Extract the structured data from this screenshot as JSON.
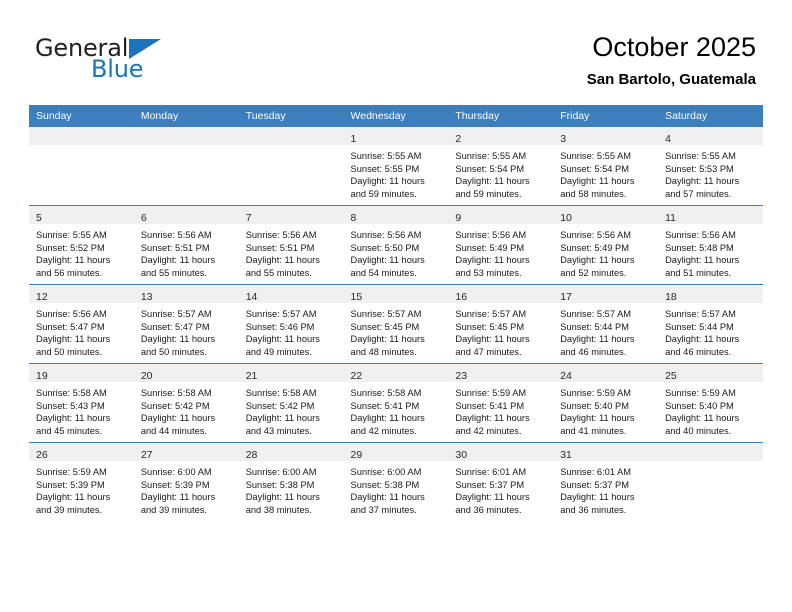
{
  "brand": {
    "name_part1": "General",
    "name_part2": "Blue"
  },
  "header": {
    "title": "October 2025",
    "subtitle": "San Bartolo, Guatemala"
  },
  "colors": {
    "header_blue": "#3d7ebd",
    "brand_blue": "#1b75bb",
    "band_gray": "#f0f0f0"
  },
  "weekdays": [
    "Sunday",
    "Monday",
    "Tuesday",
    "Wednesday",
    "Thursday",
    "Friday",
    "Saturday"
  ],
  "weeks": [
    [
      {
        "day": "",
        "sunrise": "",
        "sunset": "",
        "daylight1": "",
        "daylight2": ""
      },
      {
        "day": "",
        "sunrise": "",
        "sunset": "",
        "daylight1": "",
        "daylight2": ""
      },
      {
        "day": "",
        "sunrise": "",
        "sunset": "",
        "daylight1": "",
        "daylight2": ""
      },
      {
        "day": "1",
        "sunrise": "Sunrise: 5:55 AM",
        "sunset": "Sunset: 5:55 PM",
        "daylight1": "Daylight: 11 hours",
        "daylight2": "and 59 minutes."
      },
      {
        "day": "2",
        "sunrise": "Sunrise: 5:55 AM",
        "sunset": "Sunset: 5:54 PM",
        "daylight1": "Daylight: 11 hours",
        "daylight2": "and 59 minutes."
      },
      {
        "day": "3",
        "sunrise": "Sunrise: 5:55 AM",
        "sunset": "Sunset: 5:54 PM",
        "daylight1": "Daylight: 11 hours",
        "daylight2": "and 58 minutes."
      },
      {
        "day": "4",
        "sunrise": "Sunrise: 5:55 AM",
        "sunset": "Sunset: 5:53 PM",
        "daylight1": "Daylight: 11 hours",
        "daylight2": "and 57 minutes."
      }
    ],
    [
      {
        "day": "5",
        "sunrise": "Sunrise: 5:55 AM",
        "sunset": "Sunset: 5:52 PM",
        "daylight1": "Daylight: 11 hours",
        "daylight2": "and 56 minutes."
      },
      {
        "day": "6",
        "sunrise": "Sunrise: 5:56 AM",
        "sunset": "Sunset: 5:51 PM",
        "daylight1": "Daylight: 11 hours",
        "daylight2": "and 55 minutes."
      },
      {
        "day": "7",
        "sunrise": "Sunrise: 5:56 AM",
        "sunset": "Sunset: 5:51 PM",
        "daylight1": "Daylight: 11 hours",
        "daylight2": "and 55 minutes."
      },
      {
        "day": "8",
        "sunrise": "Sunrise: 5:56 AM",
        "sunset": "Sunset: 5:50 PM",
        "daylight1": "Daylight: 11 hours",
        "daylight2": "and 54 minutes."
      },
      {
        "day": "9",
        "sunrise": "Sunrise: 5:56 AM",
        "sunset": "Sunset: 5:49 PM",
        "daylight1": "Daylight: 11 hours",
        "daylight2": "and 53 minutes."
      },
      {
        "day": "10",
        "sunrise": "Sunrise: 5:56 AM",
        "sunset": "Sunset: 5:49 PM",
        "daylight1": "Daylight: 11 hours",
        "daylight2": "and 52 minutes."
      },
      {
        "day": "11",
        "sunrise": "Sunrise: 5:56 AM",
        "sunset": "Sunset: 5:48 PM",
        "daylight1": "Daylight: 11 hours",
        "daylight2": "and 51 minutes."
      }
    ],
    [
      {
        "day": "12",
        "sunrise": "Sunrise: 5:56 AM",
        "sunset": "Sunset: 5:47 PM",
        "daylight1": "Daylight: 11 hours",
        "daylight2": "and 50 minutes."
      },
      {
        "day": "13",
        "sunrise": "Sunrise: 5:57 AM",
        "sunset": "Sunset: 5:47 PM",
        "daylight1": "Daylight: 11 hours",
        "daylight2": "and 50 minutes."
      },
      {
        "day": "14",
        "sunrise": "Sunrise: 5:57 AM",
        "sunset": "Sunset: 5:46 PM",
        "daylight1": "Daylight: 11 hours",
        "daylight2": "and 49 minutes."
      },
      {
        "day": "15",
        "sunrise": "Sunrise: 5:57 AM",
        "sunset": "Sunset: 5:45 PM",
        "daylight1": "Daylight: 11 hours",
        "daylight2": "and 48 minutes."
      },
      {
        "day": "16",
        "sunrise": "Sunrise: 5:57 AM",
        "sunset": "Sunset: 5:45 PM",
        "daylight1": "Daylight: 11 hours",
        "daylight2": "and 47 minutes."
      },
      {
        "day": "17",
        "sunrise": "Sunrise: 5:57 AM",
        "sunset": "Sunset: 5:44 PM",
        "daylight1": "Daylight: 11 hours",
        "daylight2": "and 46 minutes."
      },
      {
        "day": "18",
        "sunrise": "Sunrise: 5:57 AM",
        "sunset": "Sunset: 5:44 PM",
        "daylight1": "Daylight: 11 hours",
        "daylight2": "and 46 minutes."
      }
    ],
    [
      {
        "day": "19",
        "sunrise": "Sunrise: 5:58 AM",
        "sunset": "Sunset: 5:43 PM",
        "daylight1": "Daylight: 11 hours",
        "daylight2": "and 45 minutes."
      },
      {
        "day": "20",
        "sunrise": "Sunrise: 5:58 AM",
        "sunset": "Sunset: 5:42 PM",
        "daylight1": "Daylight: 11 hours",
        "daylight2": "and 44 minutes."
      },
      {
        "day": "21",
        "sunrise": "Sunrise: 5:58 AM",
        "sunset": "Sunset: 5:42 PM",
        "daylight1": "Daylight: 11 hours",
        "daylight2": "and 43 minutes."
      },
      {
        "day": "22",
        "sunrise": "Sunrise: 5:58 AM",
        "sunset": "Sunset: 5:41 PM",
        "daylight1": "Daylight: 11 hours",
        "daylight2": "and 42 minutes."
      },
      {
        "day": "23",
        "sunrise": "Sunrise: 5:59 AM",
        "sunset": "Sunset: 5:41 PM",
        "daylight1": "Daylight: 11 hours",
        "daylight2": "and 42 minutes."
      },
      {
        "day": "24",
        "sunrise": "Sunrise: 5:59 AM",
        "sunset": "Sunset: 5:40 PM",
        "daylight1": "Daylight: 11 hours",
        "daylight2": "and 41 minutes."
      },
      {
        "day": "25",
        "sunrise": "Sunrise: 5:59 AM",
        "sunset": "Sunset: 5:40 PM",
        "daylight1": "Daylight: 11 hours",
        "daylight2": "and 40 minutes."
      }
    ],
    [
      {
        "day": "26",
        "sunrise": "Sunrise: 5:59 AM",
        "sunset": "Sunset: 5:39 PM",
        "daylight1": "Daylight: 11 hours",
        "daylight2": "and 39 minutes."
      },
      {
        "day": "27",
        "sunrise": "Sunrise: 6:00 AM",
        "sunset": "Sunset: 5:39 PM",
        "daylight1": "Daylight: 11 hours",
        "daylight2": "and 39 minutes."
      },
      {
        "day": "28",
        "sunrise": "Sunrise: 6:00 AM",
        "sunset": "Sunset: 5:38 PM",
        "daylight1": "Daylight: 11 hours",
        "daylight2": "and 38 minutes."
      },
      {
        "day": "29",
        "sunrise": "Sunrise: 6:00 AM",
        "sunset": "Sunset: 5:38 PM",
        "daylight1": "Daylight: 11 hours",
        "daylight2": "and 37 minutes."
      },
      {
        "day": "30",
        "sunrise": "Sunrise: 6:01 AM",
        "sunset": "Sunset: 5:37 PM",
        "daylight1": "Daylight: 11 hours",
        "daylight2": "and 36 minutes."
      },
      {
        "day": "31",
        "sunrise": "Sunrise: 6:01 AM",
        "sunset": "Sunset: 5:37 PM",
        "daylight1": "Daylight: 11 hours",
        "daylight2": "and 36 minutes."
      },
      {
        "day": "",
        "sunrise": "",
        "sunset": "",
        "daylight1": "",
        "daylight2": ""
      }
    ]
  ]
}
